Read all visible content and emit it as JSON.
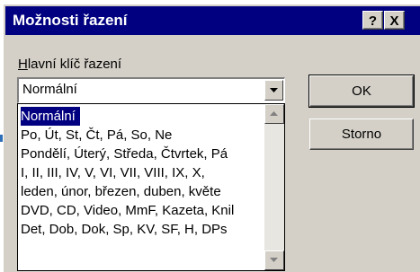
{
  "dialog": {
    "title": "Možnosti řazení",
    "help_glyph": "?",
    "close_glyph": "X"
  },
  "key_label": {
    "accel": "H",
    "rest": "lavní klíč řazení"
  },
  "combo": {
    "value": "Normální"
  },
  "list": {
    "items": [
      "Normální",
      "Po, Út, St, Čt, Pá, So, Ne",
      "Pondělí, Úterý, Středa, Čtvrtek, Pá",
      "I, II, III, IV, V, VI, VII, VIII, IX, X,",
      "leden, únor, březen, duben, květe",
      "DVD, CD, Video, MmF, Kazeta, Knil",
      "Det, Dob, Dok, Sp, KV, SF, H, DPs"
    ],
    "selected_index": 0
  },
  "buttons": {
    "ok": "OK",
    "cancel": "Storno"
  },
  "colors": {
    "titlebar": "#000080",
    "face": "#d4d0c8",
    "selection": "#000080",
    "pointer": "#2e6fb8"
  },
  "icons": {
    "pointer": "arrow-pointer-icon",
    "combo_arrow": "chevron-down-icon",
    "scroll_up": "scroll-up-icon",
    "scroll_down": "scroll-down-icon"
  }
}
